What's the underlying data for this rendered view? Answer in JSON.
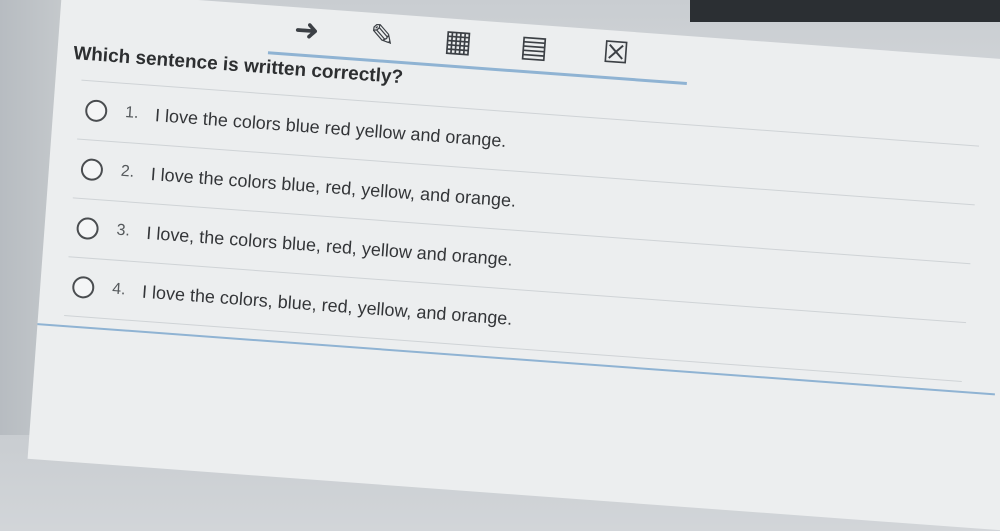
{
  "toolbar": {
    "tools": [
      {
        "icon": "arrow-icon"
      },
      {
        "icon": "eraser-icon"
      },
      {
        "icon": "calculator-icon"
      },
      {
        "icon": "notepad-icon"
      },
      {
        "icon": "flag-icon"
      }
    ]
  },
  "question": {
    "text": "Which sentence is written correctly?"
  },
  "options": [
    {
      "number": "1.",
      "text": "I love the colors blue red yellow and orange."
    },
    {
      "number": "2.",
      "text": "I love the colors blue, red, yellow, and orange."
    },
    {
      "number": "3.",
      "text": "I love, the colors blue, red, yellow and orange."
    },
    {
      "number": "4.",
      "text": "I love the colors, blue, red, yellow, and orange."
    }
  ]
}
